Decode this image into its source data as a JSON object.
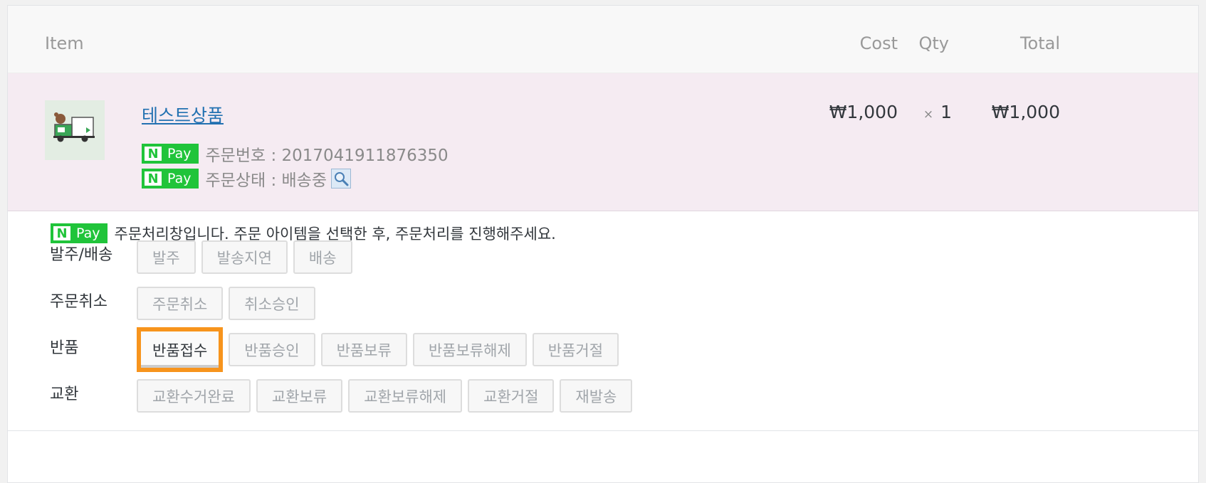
{
  "table": {
    "headers": {
      "item": "Item",
      "cost": "Cost",
      "qty": "Qty",
      "total": "Total"
    },
    "row": {
      "product_name": "테스트상품",
      "order_number_text": "주문번호 : 2017041911876350",
      "order_status_text": "주문상태 : 배송중",
      "cost": "₩1,000",
      "qty_symbol": "×",
      "qty": "1",
      "total": "₩1,000"
    }
  },
  "npay_badge": {
    "n": "N",
    "pay": "Pay"
  },
  "processing": {
    "intro": "주문처리창입니다. 주문 아이템을 선택한 후, 주문처리를 진행해주세요.",
    "groups": [
      {
        "label": "발주/배송",
        "buttons": [
          "발주",
          "발송지연",
          "배송"
        ]
      },
      {
        "label": "주문취소",
        "buttons": [
          "주문취소",
          "취소승인"
        ]
      },
      {
        "label": "반품",
        "buttons": [
          "반품접수",
          "반품승인",
          "반품보류",
          "반품보류해제",
          "반품거절"
        ]
      },
      {
        "label": "교환",
        "buttons": [
          "교환수거완료",
          "교환보류",
          "교환보류해제",
          "교환거절",
          "재발송"
        ]
      }
    ],
    "highlighted_button": "반품접수"
  },
  "colors": {
    "npay_green": "#20c43a",
    "highlight_orange": "#f7941d",
    "row_background": "#f5ebf2",
    "link_blue": "#2271b1"
  },
  "icons": {
    "status_lookup": "magnifier-icon",
    "thumbnail": "delivery-truck-thumbnail"
  }
}
